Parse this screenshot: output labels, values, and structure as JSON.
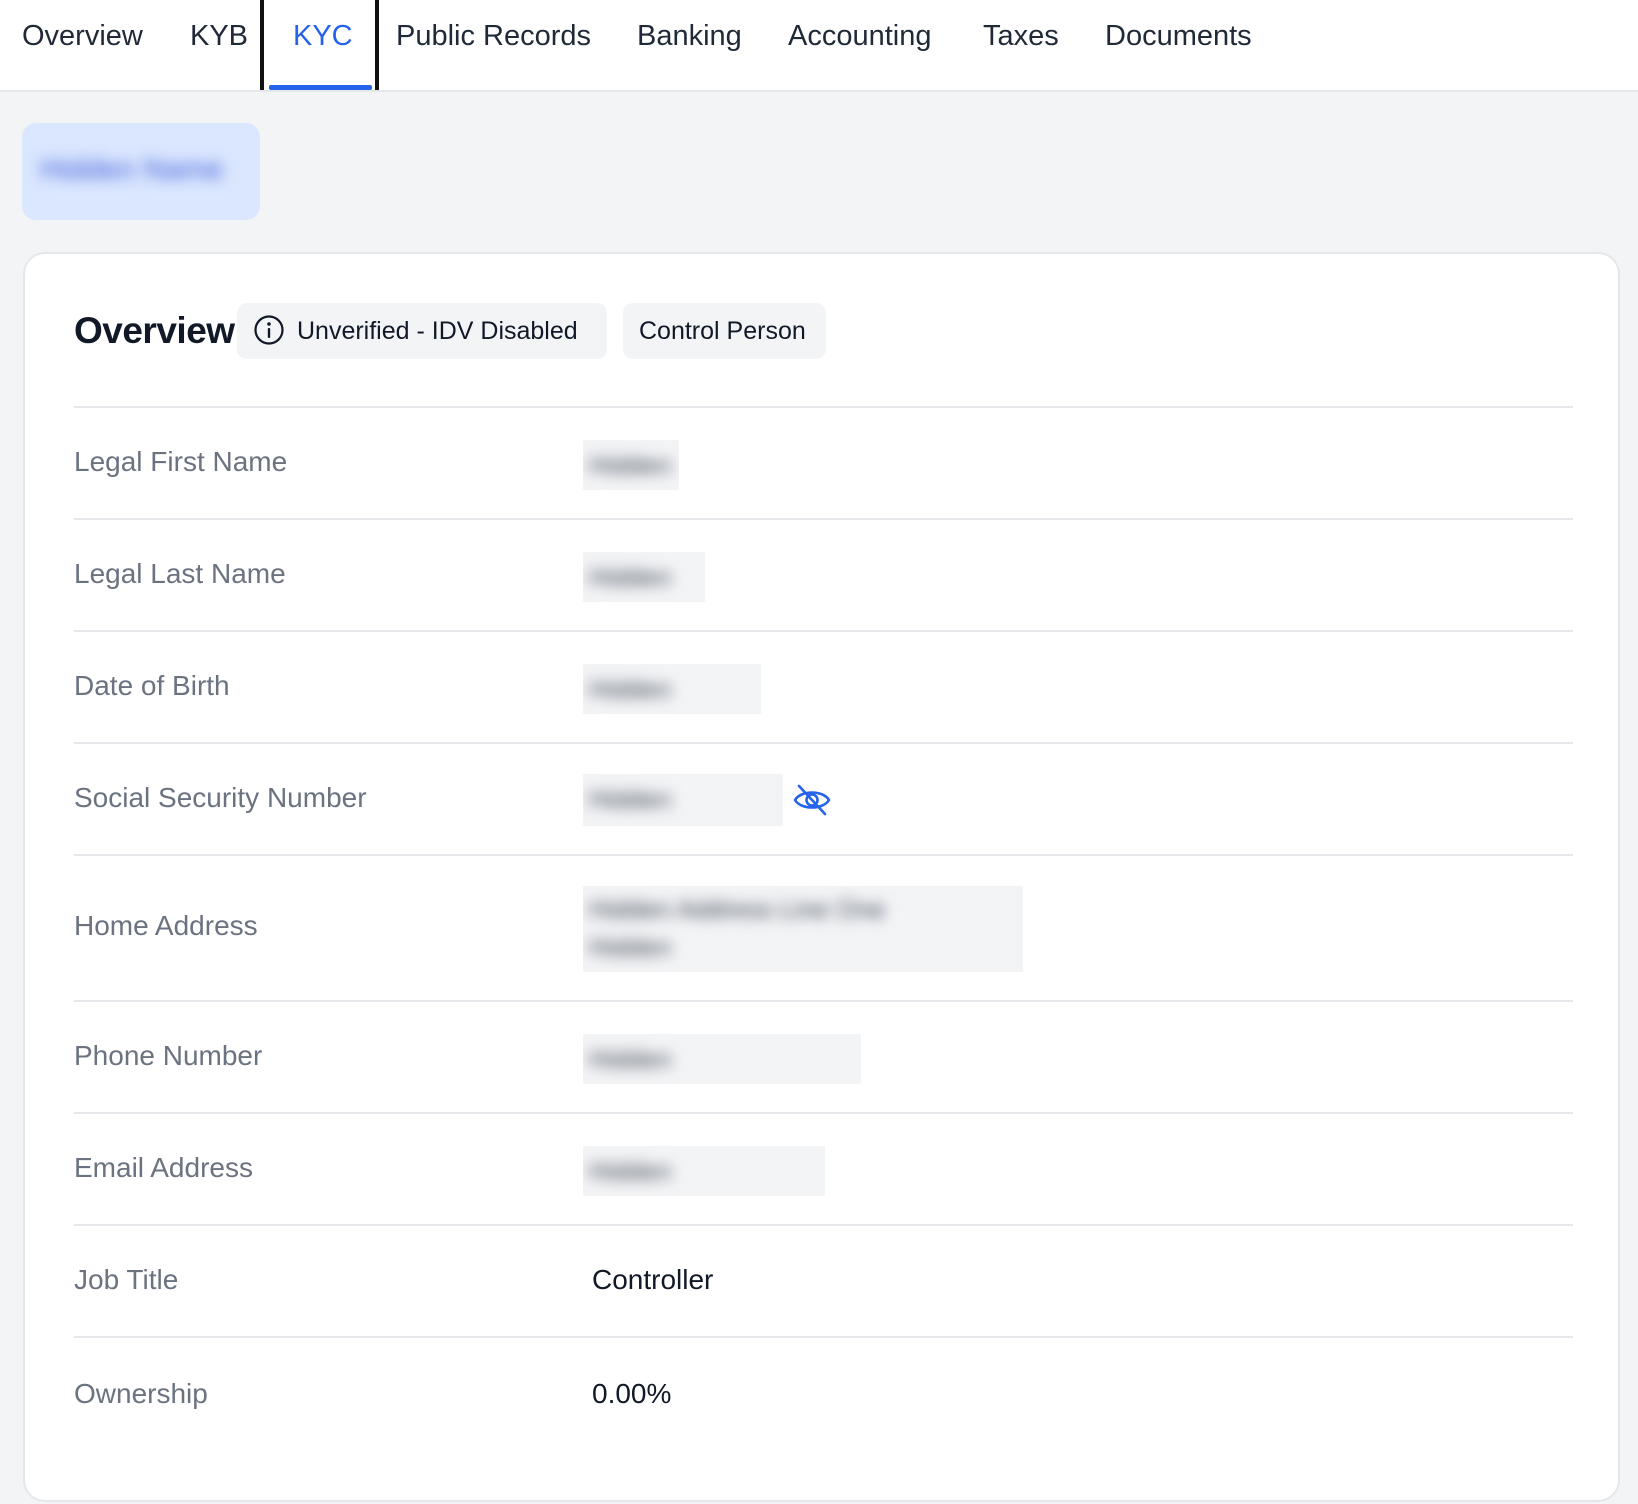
{
  "tabs": [
    {
      "label": "Overview"
    },
    {
      "label": "KYB"
    },
    {
      "label": "KYC",
      "active": true
    },
    {
      "label": "Public Records"
    },
    {
      "label": "Banking"
    },
    {
      "label": "Accounting"
    },
    {
      "label": "Taxes"
    },
    {
      "label": "Documents"
    }
  ],
  "person_chip": {
    "name": "Hidden Name"
  },
  "card": {
    "title": "Overview",
    "badges": {
      "status": "Unverified - IDV Disabled",
      "role": "Control Person"
    },
    "fields": {
      "legal_first_name": {
        "label": "Legal First Name",
        "value": "Hidden"
      },
      "legal_last_name": {
        "label": "Legal Last Name",
        "value": "Hidden"
      },
      "date_of_birth": {
        "label": "Date of Birth",
        "value": "Hidden"
      },
      "ssn": {
        "label": "Social Security Number",
        "value": "Hidden"
      },
      "home_address": {
        "label": "Home Address",
        "line1": "Hidden Address Line One",
        "line2": "Hidden"
      },
      "phone": {
        "label": "Phone Number",
        "value": "Hidden"
      },
      "email": {
        "label": "Email Address",
        "value": "Hidden"
      },
      "job_title": {
        "label": "Job Title",
        "value": "Controller"
      },
      "ownership": {
        "label": "Ownership",
        "value": "0.00%"
      }
    }
  },
  "colors": {
    "accent": "#2563eb",
    "background": "#f3f4f6",
    "card": "#ffffff",
    "label": "#6b7280"
  },
  "icons": {
    "status_badge": "info-icon",
    "ssn_toggle": "eye-off-icon"
  }
}
